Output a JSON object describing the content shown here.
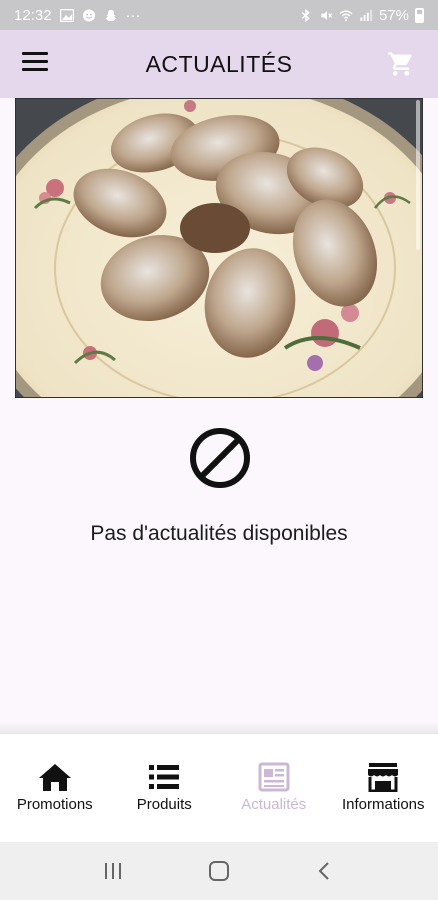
{
  "status_bar": {
    "time": "12:32",
    "dots": "···",
    "battery_percent": "57%"
  },
  "app_bar": {
    "title": "ACTUALITÉS",
    "menu_icon": "hamburger-menu-icon",
    "cart_icon": "shopping-cart-icon"
  },
  "hero": {
    "description_icon": "pastry-photo"
  },
  "empty_state": {
    "icon": "no-entry-icon",
    "message": "Pas d'actualités disponibles"
  },
  "bottom_nav": {
    "items": [
      {
        "label": "Promotions",
        "icon": "home-icon",
        "active": false
      },
      {
        "label": "Produits",
        "icon": "list-icon",
        "active": false
      },
      {
        "label": "Actualités",
        "icon": "newspaper-icon",
        "active": true
      },
      {
        "label": "Informations",
        "icon": "store-icon",
        "active": false
      }
    ]
  },
  "colors": {
    "app_bar": "#e6d8ec",
    "active_nav": "#cbb8d6",
    "background": "#fbf7fc"
  }
}
